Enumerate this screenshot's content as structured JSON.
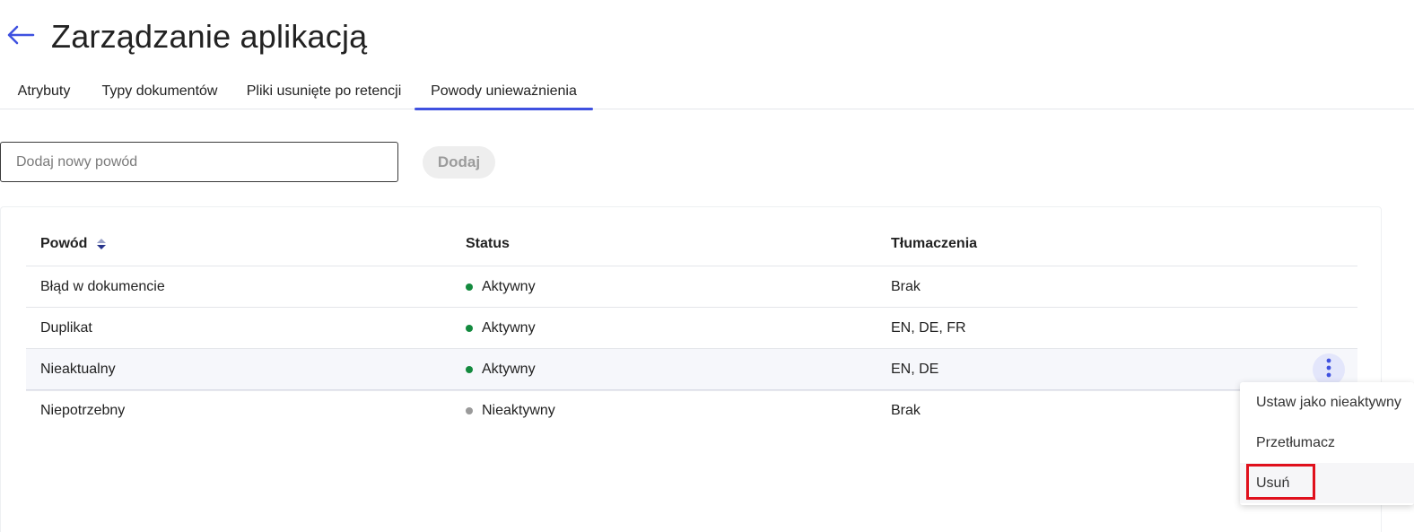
{
  "header": {
    "back_icon": "arrow-left-icon",
    "title": "Zarządzanie aplikacją"
  },
  "tabs": [
    {
      "label": "Atrybuty",
      "active": false
    },
    {
      "label": "Typy dokumentów",
      "active": false
    },
    {
      "label": "Pliki usunięte po retencji",
      "active": false
    },
    {
      "label": "Powody unieważnienia",
      "active": true
    }
  ],
  "add_form": {
    "input_value": "",
    "input_placeholder": "Dodaj nowy powód",
    "button_label": "Dodaj"
  },
  "table": {
    "columns": [
      "Powód",
      "Status",
      "Tłumaczenia"
    ],
    "sort_icon": "sort-icon",
    "rows": [
      {
        "reason": "Błąd w dokumencie",
        "status": "Aktywny",
        "status_kind": "active",
        "translations": "Brak"
      },
      {
        "reason": "Duplikat",
        "status": "Aktywny",
        "status_kind": "active",
        "translations": "EN, DE, FR"
      },
      {
        "reason": "Nieaktualny",
        "status": "Aktywny",
        "status_kind": "active",
        "translations": "EN, DE"
      },
      {
        "reason": "Niepotrzebny",
        "status": "Nieaktywny",
        "status_kind": "inactive",
        "translations": "Brak"
      }
    ]
  },
  "row_menu": {
    "icon": "more-vertical-icon",
    "items": [
      "Ustaw jako nieaktywny",
      "Przetłumacz",
      "Usuń"
    ]
  },
  "colors": {
    "accent": "#3f51e0",
    "active_status": "#138a3e",
    "inactive_status": "#9a9a9a",
    "highlight_border": "#e0101c"
  }
}
